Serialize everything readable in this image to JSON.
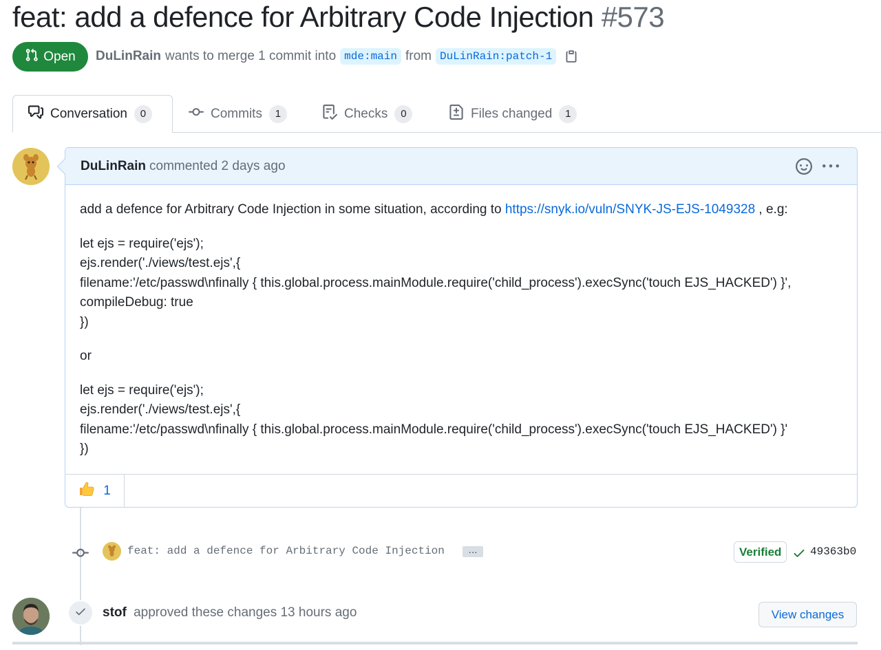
{
  "pr": {
    "title": "feat: add a defence for Arbitrary Code Injection",
    "number": "#573",
    "state": "Open",
    "author": "DuLinRain",
    "merge_text": "wants to merge 1 commit into",
    "base_branch": "mde:main",
    "from_text": "from",
    "head_branch": "DuLinRain:patch-1"
  },
  "tabs": [
    {
      "label": "Conversation",
      "count": "0",
      "icon": "comment-discussion-icon"
    },
    {
      "label": "Commits",
      "count": "1",
      "icon": "git-commit-icon"
    },
    {
      "label": "Checks",
      "count": "0",
      "icon": "checklist-icon"
    },
    {
      "label": "Files changed",
      "count": "1",
      "icon": "file-diff-icon"
    }
  ],
  "comment": {
    "author": "DuLinRain",
    "action": "commented 2 days ago",
    "intro": "add a defence for Arbitrary Code Injection in some situation, according to ",
    "link": "https://snyk.io/vuln/SNYK-JS-EJS-1049328",
    "intro_end": " , e.g:",
    "code1": [
      "let ejs = require('ejs');",
      "ejs.render('./views/test.ejs',{",
      "filename:'/etc/passwd\\nfinally { this.global.process.mainModule.require('child_process').execSync('touch EJS_HACKED') }',",
      "compileDebug: true",
      "})"
    ],
    "or": "or",
    "code2": [
      "let ejs = require('ejs');",
      "ejs.render('./views/test.ejs',{",
      "filename:'/etc/passwd\\nfinally { this.global.process.mainModule.require('child_process').execSync('touch EJS_HACKED') }'",
      "})"
    ],
    "reaction_count": "1"
  },
  "commit": {
    "message": "feat: add a defence for Arbitrary Code Injection",
    "ellipsis": "···",
    "verified": "Verified",
    "sha": "49363b0"
  },
  "review": {
    "author": "stof",
    "action": "approved these changes 13 hours ago",
    "button": "View changes"
  },
  "colors": {
    "open_green": "#1f883d",
    "link_blue": "#0969da",
    "header_blue": "#eaf4fd",
    "muted_text": "#656d76"
  }
}
